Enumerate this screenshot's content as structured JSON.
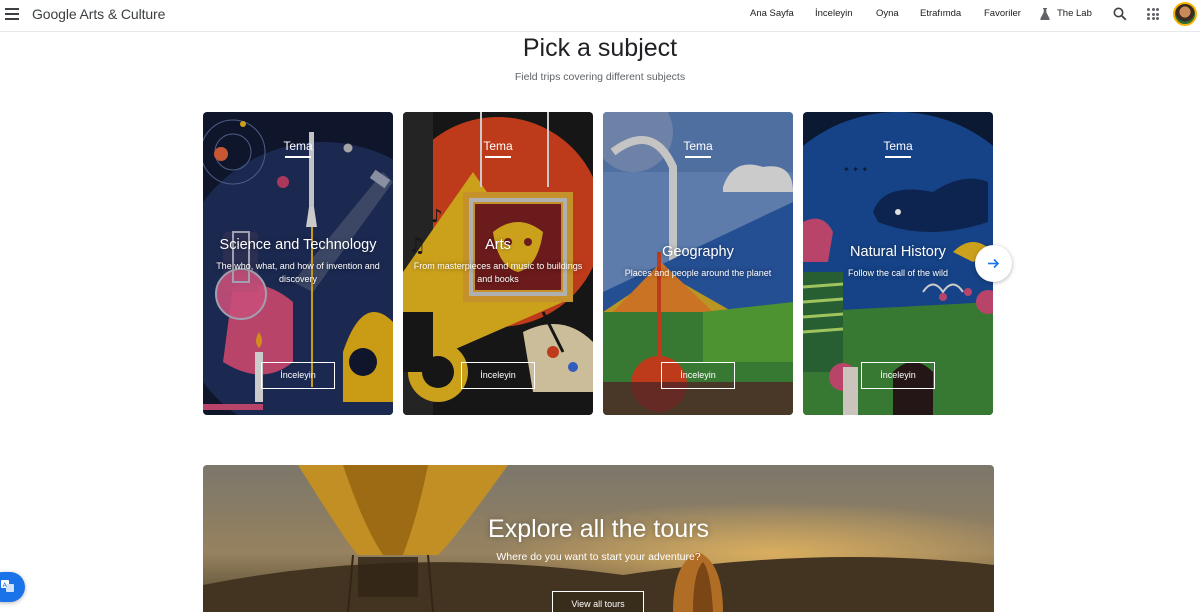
{
  "header": {
    "logo": "Google Arts & Culture",
    "nav": [
      "Ana Sayfa",
      "İnceleyin",
      "Oyna",
      "Etrafımda",
      "Favoriler",
      "The Lab"
    ]
  },
  "section": {
    "title": "Pick a subject",
    "subtitle": "Field trips covering different subjects"
  },
  "cards": [
    {
      "kicker": "Tema",
      "title": "Science and Technology",
      "description": "The who, what, and how of invention and discovery",
      "button": "İnceleyin"
    },
    {
      "kicker": "Tema",
      "title": "Arts",
      "description": "From masterpieces and music to buildings and books",
      "button": "İnceleyin"
    },
    {
      "kicker": "Tema",
      "title": "Geography",
      "description": "Places and people around the planet",
      "button": "İnceleyin"
    },
    {
      "kicker": "Tema",
      "title": "Natural History",
      "description": "Follow the call of the wild",
      "button": "İnceleyin"
    }
  ],
  "banner": {
    "title": "Explore all the tours",
    "subtitle": "Where do you want to start your adventure?",
    "button": "View all tours"
  },
  "icons": [
    "menu-icon",
    "lab-flask-icon",
    "search-icon",
    "apps-grid-icon",
    "arrow-right-icon",
    "translate-icon"
  ],
  "colors": {
    "accent": "#1a73e8",
    "card_overlay_text": "#ffffff"
  }
}
